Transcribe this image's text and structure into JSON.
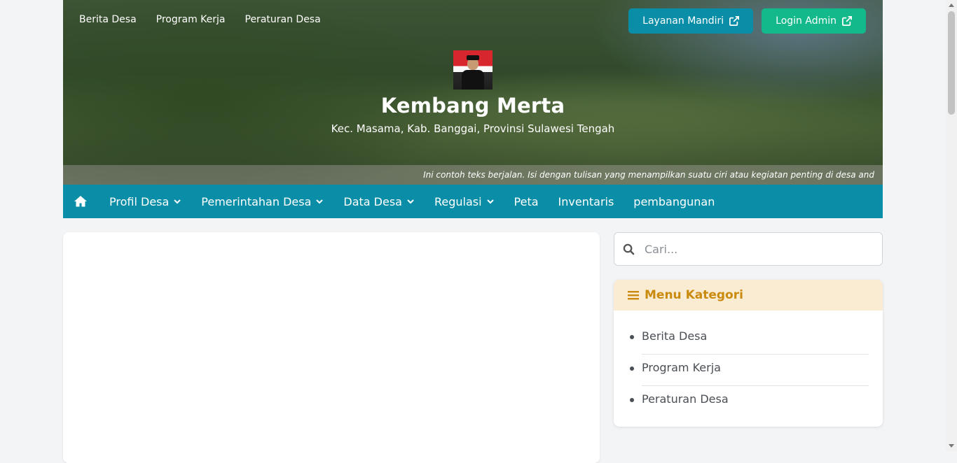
{
  "top_nav": [
    {
      "label": "Berita Desa"
    },
    {
      "label": "Program Kerja"
    },
    {
      "label": "Peraturan Desa"
    }
  ],
  "buttons": {
    "layanan_label": "Layanan Mandiri",
    "login_label": "Login Admin",
    "layanan_color": "#0a8ea8",
    "login_color": "#13b98a"
  },
  "site": {
    "title": "Kembang Merta",
    "subtitle": "Kec. Masama, Kab. Banggai, Provinsi Sulawesi Tengah",
    "marquee": "Ini contoh teks berjalan. Isi dengan tulisan yang menampilkan suatu ciri atau kegiatan penting di desa and"
  },
  "main_nav": [
    {
      "label": "Profil Desa",
      "dropdown": true
    },
    {
      "label": "Pemerintahan Desa",
      "dropdown": true
    },
    {
      "label": "Data Desa",
      "dropdown": true
    },
    {
      "label": "Regulasi",
      "dropdown": true
    },
    {
      "label": "Peta",
      "dropdown": false
    },
    {
      "label": "Inventaris",
      "dropdown": false
    },
    {
      "label": "pembangunan",
      "dropdown": false
    }
  ],
  "search": {
    "placeholder": "Cari..."
  },
  "kategori": {
    "title": "Menu Kategori",
    "items": [
      {
        "label": "Berita Desa"
      },
      {
        "label": "Program Kerja"
      },
      {
        "label": "Peraturan Desa"
      }
    ]
  },
  "colors": {
    "nav_bg": "#0a8ea8",
    "accent": "#c98a0e"
  }
}
